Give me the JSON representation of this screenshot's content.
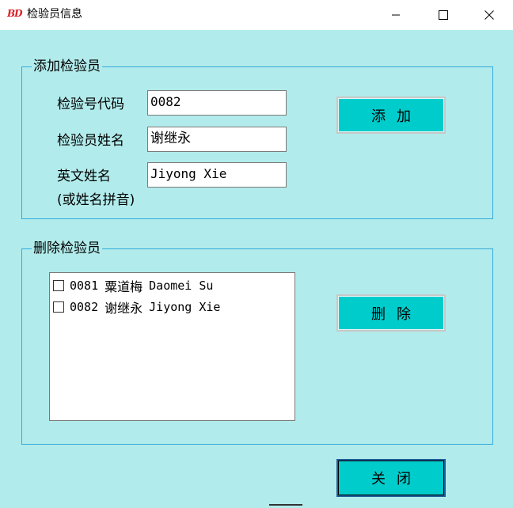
{
  "window": {
    "icon_text": "BD",
    "title": "检验员信息",
    "controls": [
      "minimize-icon",
      "maximize-icon",
      "close-icon"
    ]
  },
  "add_group": {
    "title": "添加检验员",
    "code_label": "检验号代码",
    "code_value": "0082",
    "name_label": "检验员姓名",
    "name_value": "谢继永",
    "en_label": "英文姓名",
    "en_note": "(或姓名拼音)",
    "en_value": "Jiyong Xie",
    "add_button": "添加"
  },
  "delete_group": {
    "title": "删除检验员",
    "items": [
      {
        "code": "0081",
        "cn": "粟道梅",
        "en": "Daomei Su",
        "checked": false
      },
      {
        "code": "0082",
        "cn": "谢继永",
        "en": "Jiyong Xie",
        "checked": false
      }
    ],
    "delete_button": "删除"
  },
  "close_button": "关闭",
  "colors": {
    "background": "#b2ebeb",
    "button": "#00cccc",
    "group_border": "#33aadd"
  }
}
